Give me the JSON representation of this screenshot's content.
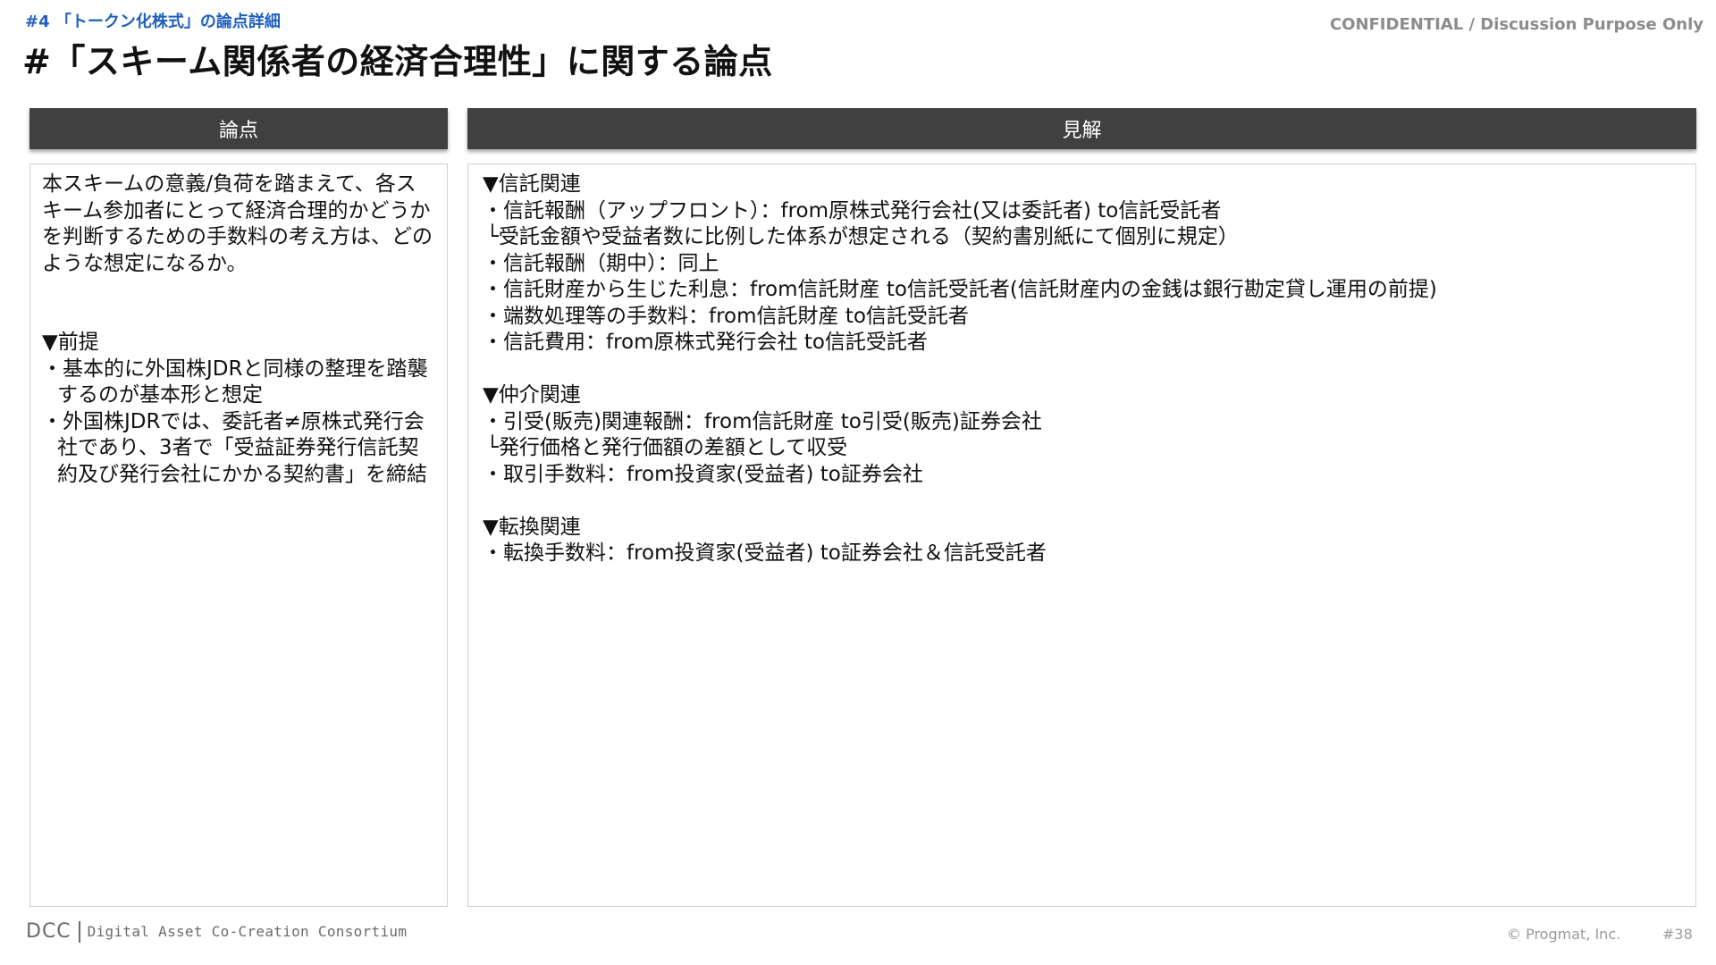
{
  "header": {
    "breadcrumb": "#4 「トークン化株式」の論点詳細",
    "confidential": "CONFIDENTIAL / Discussion Purpose Only",
    "title": "#「スキーム関係者の経済合理性」に関する論点"
  },
  "columns": {
    "left_header": "論点",
    "right_header": "見解"
  },
  "left_panel": {
    "question": "本スキームの意義/負荷を踏まえて、各スキーム参加者にとって経済合理的かどうかを判断するための手数料の考え方は、どのような想定になるか。",
    "premise_heading": "▼前提",
    "premise_items": [
      "・基本的に外国株JDRと同様の整理を踏襲するのが基本形と想定",
      "・外国株JDRでは、委託者≠原株式発行会社であり、3者で「受益証券発行信託契約及び発行会社にかかる契約書」を締結"
    ]
  },
  "right_panel": {
    "trust_heading": "▼信託関連",
    "trust_lines": [
      "・信託報酬（アップフロント）：from原株式発行会社(又は委託者) to信託受託者",
      "└受託金額や受益者数に比例した体系が想定される（契約書別紙にて個別に規定）",
      "・信託報酬（期中）：同上",
      "・信託財産から生じた利息：from信託財産 to信託受託者(信託財産内の金銭は銀行勘定貸し運用の前提)",
      "・端数処理等の手数料：from信託財産 to信託受託者",
      "・信託費用：from原株式発行会社 to信託受託者"
    ],
    "intermediary_heading": "▼仲介関連",
    "intermediary_lines": [
      "・引受(販売)関連報酬：from信託財産 to引受(販売)証券会社",
      "└発行価格と発行価額の差額として収受",
      "・取引手数料：from投資家(受益者) to証券会社"
    ],
    "conversion_heading": "▼転換関連",
    "conversion_lines": [
      "・転換手数料：from投資家(受益者) to証券会社＆信託受託者"
    ]
  },
  "footer": {
    "logo_text": "DCC",
    "consortium": "Digital Asset Co-Creation Consortium",
    "copyright": "© Progmat, Inc.",
    "page_number": "#38"
  },
  "colors": {
    "breadcrumb": "#1f5fbf",
    "column_header_bg": "#404040",
    "border": "#cfcfcf"
  }
}
